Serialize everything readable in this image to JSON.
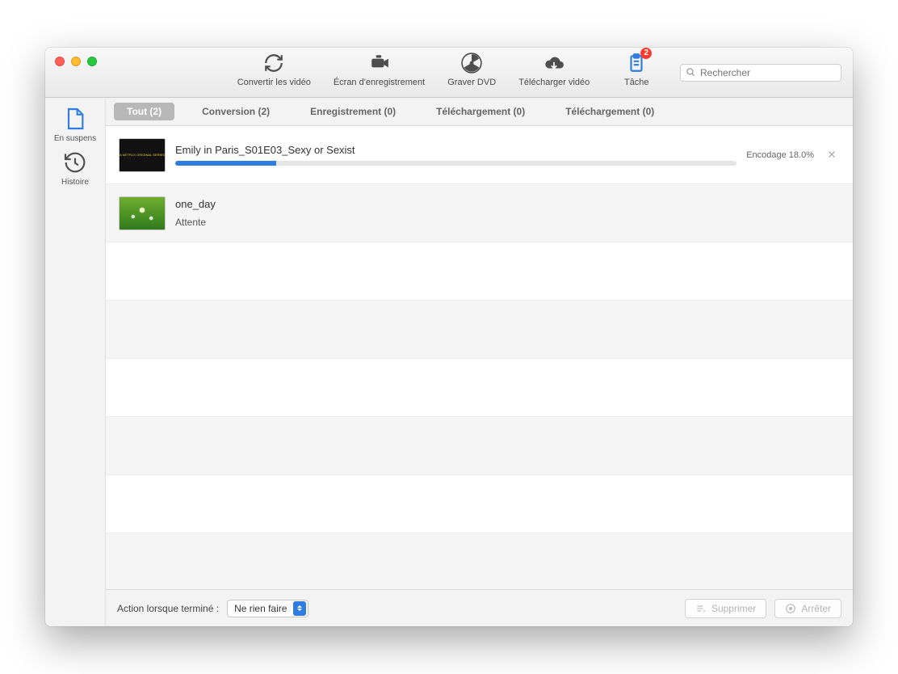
{
  "toolbar": {
    "convert": "Convertir les vidéo",
    "record": "Écran d'enregistrement",
    "burn": "Graver DVD",
    "download": "Télécharger vidéo",
    "task": "Tâche",
    "task_badge": "2"
  },
  "search": {
    "placeholder": "Rechercher"
  },
  "sidebar": {
    "pending": "En suspens",
    "history": "Histoire"
  },
  "tabs": {
    "all": "Tout (2)",
    "conversion": "Conversion (2)",
    "record": "Enregistrement (0)",
    "download1": "Téléchargement (0)",
    "download2": "Téléchargement (0)"
  },
  "tasks": [
    {
      "title": "Emily in Paris_S01E03_Sexy or Sexist",
      "status": "Encodage 18.0%",
      "progress_pct": 18
    },
    {
      "title": "one_day",
      "substatus": "Attente"
    }
  ],
  "footer": {
    "action_label": "Action lorsque terminé :",
    "select_value": "Ne rien faire",
    "delete": "Supprimer",
    "stop": "Arrêter"
  }
}
